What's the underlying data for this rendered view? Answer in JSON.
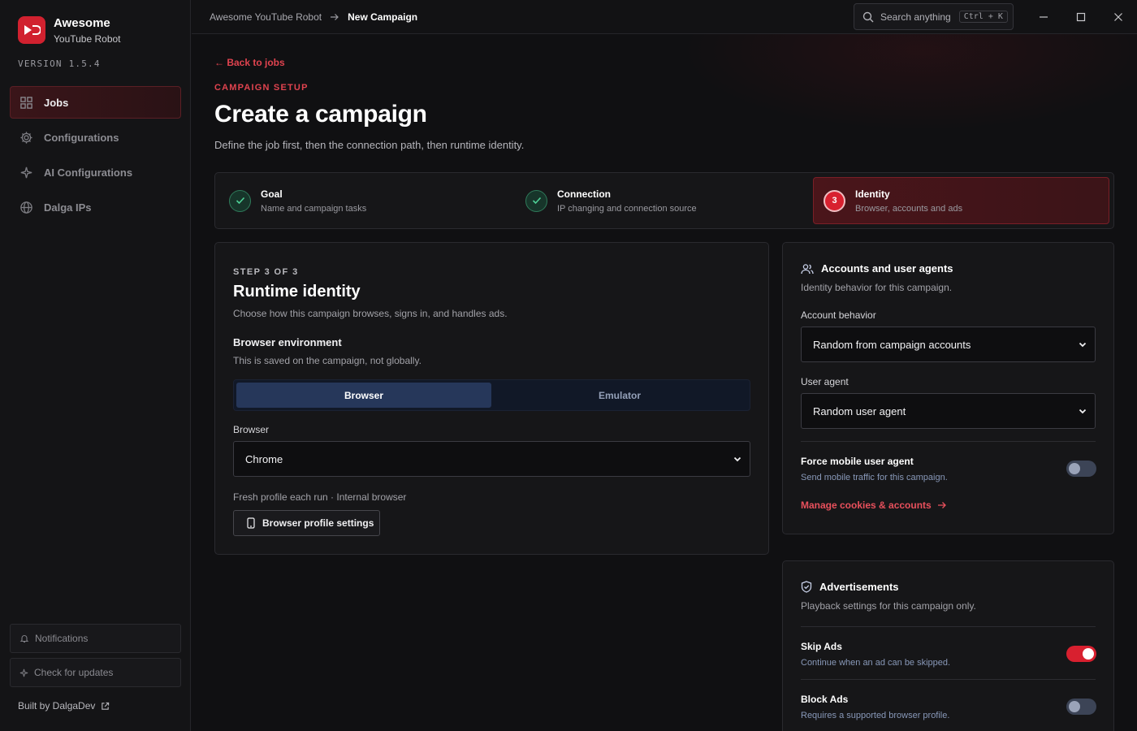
{
  "app": {
    "name": "Awesome",
    "subtitle": "YouTube Robot",
    "version": "VERSION 1.5.4"
  },
  "sidebar": {
    "items": [
      {
        "label": "Jobs",
        "icon": "grid-icon",
        "active": true
      },
      {
        "label": "Configurations",
        "icon": "gear-icon"
      },
      {
        "label": "AI Configurations",
        "icon": "sparkle-icon"
      },
      {
        "label": "Dalga IPs",
        "icon": "globe-icon"
      }
    ],
    "notifications": "Notifications",
    "check_updates": "Check for updates",
    "built_by": "Built by DalgaDev"
  },
  "topbar": {
    "crumb_root": "Awesome YouTube Robot",
    "crumb_current": "New Campaign",
    "search_placeholder": "Search anything",
    "shortcut": "Ctrl + K"
  },
  "page": {
    "back": "← Back to jobs",
    "eyebrow": "CAMPAIGN SETUP",
    "title": "Create a campaign",
    "subtitle": "Define the job first, then the connection path, then runtime identity."
  },
  "steps": [
    {
      "title": "Goal",
      "desc": "Name and campaign tasks",
      "state": "done"
    },
    {
      "title": "Connection",
      "desc": "IP changing and connection source",
      "state": "done"
    },
    {
      "number": "3",
      "title": "Identity",
      "desc": "Browser, accounts and ads",
      "state": "current"
    }
  ],
  "identity": {
    "step_label": "STEP 3 OF 3",
    "title": "Runtime identity",
    "desc": "Choose how this campaign browses, signs in, and handles ads.",
    "env_title": "Browser environment",
    "env_desc": "This is saved on the campaign, not globally.",
    "seg_browser": "Browser",
    "seg_emulator": "Emulator",
    "browser_label": "Browser",
    "browser_value": "Chrome",
    "profile_note": "Fresh profile each run · Internal browser",
    "profile_button": "Browser profile settings"
  },
  "accounts": {
    "title": "Accounts and user agents",
    "desc": "Identity behavior for this campaign.",
    "account_label": "Account behavior",
    "account_value": "Random from campaign accounts",
    "ua_label": "User agent",
    "ua_value": "Random user agent",
    "force_mobile_title": "Force mobile user agent",
    "force_mobile_desc": "Send mobile traffic for this campaign.",
    "force_mobile_on": false,
    "manage_link": "Manage cookies & accounts"
  },
  "ads": {
    "title": "Advertisements",
    "desc": "Playback settings for this campaign only.",
    "skip_title": "Skip Ads",
    "skip_desc": "Continue when an ad can be skipped.",
    "skip_on": true,
    "block_title": "Block Ads",
    "block_desc": "Requires a supported browser profile.",
    "block_on": false
  },
  "colors": {
    "accent": "#d8202f",
    "success": "#4fd197",
    "segment_active": "#26375a"
  }
}
